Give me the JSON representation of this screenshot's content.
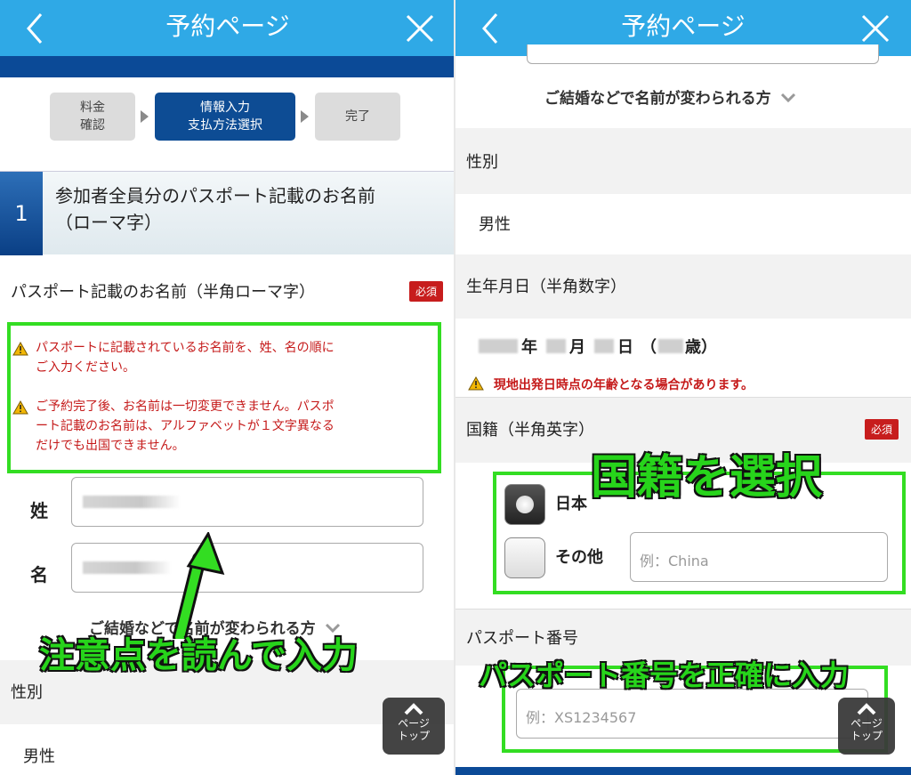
{
  "left": {
    "title": "予約ページ",
    "steps": {
      "s1_line1": "料金",
      "s1_line2": "確認",
      "s2_line1": "情報入力",
      "s2_line2": "支払方法選択",
      "s3": "完了"
    },
    "section": {
      "number": "1",
      "title_line1": "参加者全員分のパスポート記載のお名前",
      "title_line2": "（ローマ字）"
    },
    "name_label": "パスポート記載のお名前（半角ローマ字）",
    "required": "必須",
    "warnings": [
      {
        "line1": "パスポートに記載されているお名前を、姓、名の順に",
        "line2": "ご入力ください。"
      },
      {
        "line1": "ご予約完了後、お名前は一切変更できません。パスポ",
        "line2": "ート記載のお名前は、アルファベットが１文字異なる",
        "line3": "だけでも出国できません。"
      }
    ],
    "surname_label": "姓",
    "given_label": "名",
    "marriage_link": "ご結婚などで名前が変わられる方",
    "gender_label": "性別",
    "gender_value": "男性",
    "annotation": "注意点を読んで入力",
    "pagetop_line1": "ページ",
    "pagetop_line2": "トップ"
  },
  "right": {
    "title": "予約ページ",
    "marriage_link": "ご結婚などで名前が変わられる方",
    "gender_label": "性別",
    "gender_value": "男性",
    "dob_label": "生年月日（半角数字）",
    "dob_year": "年",
    "dob_month": "月",
    "dob_day": "日",
    "dob_age_open": "（",
    "dob_age_close": "歳）",
    "dob_warning": "現地出発日時点の年齢となる場合があります。",
    "nationality_label": "国籍（半角英字）",
    "required": "必須",
    "option_japan": "日本",
    "option_other": "その他",
    "other_placeholder": "例：China",
    "passport_label": "パスポート番号",
    "passport_placeholder": "例：XS1234567",
    "annotation_nationality": "国籍を選択",
    "annotation_passport": "パスポート番号を正確に入力",
    "pagetop_line1": "ページ",
    "pagetop_line2": "トップ"
  }
}
